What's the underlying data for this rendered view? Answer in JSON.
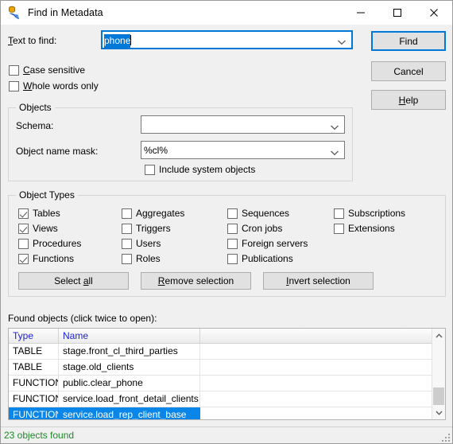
{
  "window": {
    "title": "Find in Metadata",
    "icon": "find-metadata-icon",
    "minimize_label": "Minimize",
    "maximize_label": "Maximize",
    "close_label": "Close"
  },
  "search": {
    "label": "Text to find:",
    "label_accel": "T",
    "value": "phone",
    "placeholder": ""
  },
  "options": [
    {
      "label": "Case sensitive",
      "accel": "C",
      "checked": false,
      "name": "case-sensitive"
    },
    {
      "label": "Whole words only",
      "accel": "W",
      "checked": false,
      "name": "whole-words-only"
    }
  ],
  "buttons": {
    "find": "Find",
    "cancel": "Cancel",
    "help": "Help",
    "help_accel": "H"
  },
  "objects_group": {
    "legend": "Objects",
    "schema_label": "Schema:",
    "schema_value": "",
    "mask_label": "Object name mask:",
    "mask_value": "%cl%",
    "include_system_label": "Include system objects",
    "include_system_checked": false
  },
  "object_types": {
    "legend": "Object Types",
    "items": [
      {
        "label": "Tables",
        "checked": true,
        "col": 0,
        "row": 0
      },
      {
        "label": "Views",
        "checked": true,
        "col": 0,
        "row": 1
      },
      {
        "label": "Procedures",
        "checked": false,
        "col": 0,
        "row": 2
      },
      {
        "label": "Functions",
        "checked": true,
        "col": 0,
        "row": 3
      },
      {
        "label": "Aggregates",
        "checked": false,
        "col": 1,
        "row": 0
      },
      {
        "label": "Triggers",
        "checked": false,
        "col": 1,
        "row": 1
      },
      {
        "label": "Users",
        "checked": false,
        "col": 1,
        "row": 2
      },
      {
        "label": "Roles",
        "checked": false,
        "col": 1,
        "row": 3
      },
      {
        "label": "Sequences",
        "checked": false,
        "col": 2,
        "row": 0
      },
      {
        "label": "Cron jobs",
        "checked": false,
        "col": 2,
        "row": 1
      },
      {
        "label": "Foreign servers",
        "checked": false,
        "col": 2,
        "row": 2
      },
      {
        "label": "Publications",
        "checked": false,
        "col": 2,
        "row": 3
      },
      {
        "label": "Subscriptions",
        "checked": false,
        "col": 3,
        "row": 0
      },
      {
        "label": "Extensions",
        "checked": false,
        "col": 3,
        "row": 1
      }
    ],
    "select_all": "Select all",
    "select_all_accel": "a",
    "remove_selection": "Remove selection",
    "remove_selection_accel": "R",
    "invert_selection": "Invert selection",
    "invert_selection_accel": "I"
  },
  "results": {
    "label": "Found objects (click twice to open):",
    "columns": [
      "Type",
      "Name",
      ""
    ],
    "rows": [
      {
        "type": "TABLE",
        "name": "stage.front_cl_third_parties",
        "selected": false
      },
      {
        "type": "TABLE",
        "name": "stage.old_clients",
        "selected": false
      },
      {
        "type": "FUNCTION",
        "name": "public.clear_phone",
        "selected": false
      },
      {
        "type": "FUNCTION",
        "name": "service.load_front_detail_clients",
        "selected": false
      },
      {
        "type": "FUNCTION",
        "name": "service.load_rep_client_base",
        "selected": true
      }
    ]
  },
  "status": {
    "text": "23 objects found"
  },
  "colors": {
    "accent": "#0078d7",
    "selection": "#0a86e8",
    "header_text": "#2121d0",
    "status_text": "#1d8a2a",
    "window_bg": "#f0f0f0"
  }
}
